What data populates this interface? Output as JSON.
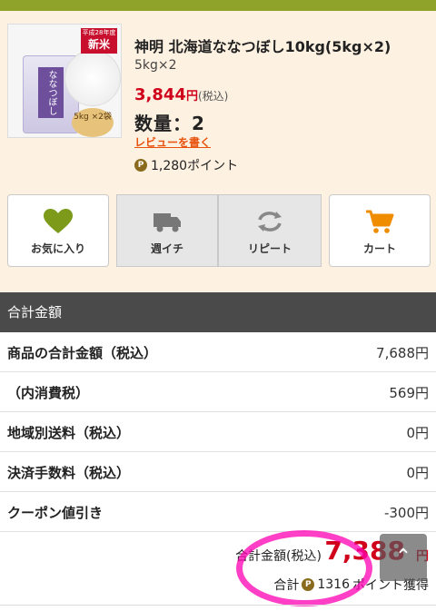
{
  "product": {
    "title": "神明 北海道ななつぼし10kg(5kg×2)",
    "subtitle": "5kg×2",
    "price": "3,844",
    "price_unit": "円",
    "price_tax": "(税込)",
    "qty_label": "数量：2",
    "review_link": "レビューを書く",
    "points": "1,280ポイント",
    "point_symbol": "P",
    "badge_year": "平成28年度",
    "badge_new": "新米",
    "bag_label": "ななつぼし",
    "coin_text": "5kg ×2袋"
  },
  "actions": [
    {
      "label": "お気に入り",
      "icon": "heart-icon"
    },
    {
      "label": "週イチ",
      "icon": "truck-icon"
    },
    {
      "label": "リピート",
      "icon": "repeat-icon"
    },
    {
      "label": "カート",
      "icon": "cart-icon"
    }
  ],
  "summary": {
    "header": "合計金額",
    "rows": [
      {
        "label": "商品の合計金額（税込）",
        "value": "7,688円"
      },
      {
        "label": "（内消費税）",
        "value": "569円"
      },
      {
        "label": "地域別送料（税込）",
        "value": "0円"
      },
      {
        "label": "決済手数料（税込）",
        "value": "0円"
      },
      {
        "label": "クーポン値引き",
        "value": "-300円"
      }
    ],
    "total_label": "合計金額(税込)",
    "total_amount": "7,388",
    "total_unit": "円",
    "points_prefix": "合計",
    "points_value": "1316",
    "points_suffix": "ポイント獲得"
  },
  "colors": {
    "price_red": "#d0021b",
    "accent_green": "#8fa32a",
    "review_orange": "#e8520c",
    "cart_orange": "#f08c00",
    "heart_green": "#7d9a1a"
  }
}
